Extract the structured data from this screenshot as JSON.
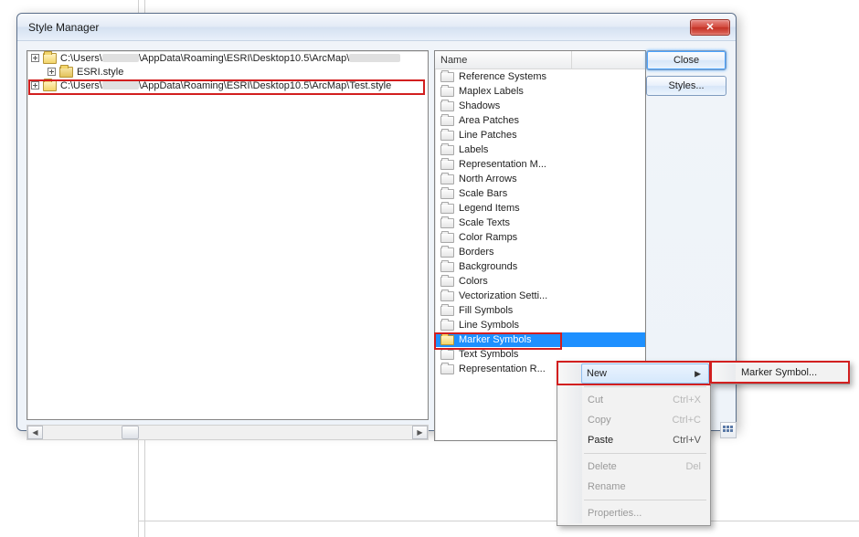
{
  "window": {
    "title": "Style Manager"
  },
  "buttons": {
    "close": "Close",
    "styles": "Styles..."
  },
  "tree": {
    "items": [
      {
        "label_prefix": "C:\\Users\\",
        "label_mid_redacted": true,
        "label_suffix": "\\AppData\\Roaming\\ESRI\\Desktop10.5\\ArcMap\\",
        "label_tail_redacted": true,
        "open": true
      },
      {
        "label_prefix": "ESRI.style",
        "open": false
      },
      {
        "label_prefix": "C:\\Users\\",
        "label_mid_redacted": true,
        "label_suffix": "\\AppData\\Roaming\\ESRI\\Desktop10.5\\ArcMap\\Test.style",
        "open": true,
        "highlight": true
      }
    ]
  },
  "list": {
    "column": "Name",
    "items": [
      "Reference Systems",
      "Maplex Labels",
      "Shadows",
      "Area Patches",
      "Line Patches",
      "Labels",
      "Representation M...",
      "North Arrows",
      "Scale Bars",
      "Legend Items",
      "Scale Texts",
      "Color Ramps",
      "Borders",
      "Backgrounds",
      "Colors",
      "Vectorization Setti...",
      "Fill Symbols",
      "Line Symbols",
      "Marker Symbols",
      "Text Symbols",
      "Representation R..."
    ],
    "selected_index": 18
  },
  "context_menu": {
    "new": "New",
    "cut": "Cut",
    "copy": "Copy",
    "paste": "Paste",
    "delete": "Delete",
    "rename": "Rename",
    "properties": "Properties...",
    "shortcuts": {
      "cut": "Ctrl+X",
      "copy": "Ctrl+C",
      "paste": "Ctrl+V",
      "delete": "Del"
    },
    "submenu": {
      "marker_symbol": "Marker Symbol..."
    }
  }
}
